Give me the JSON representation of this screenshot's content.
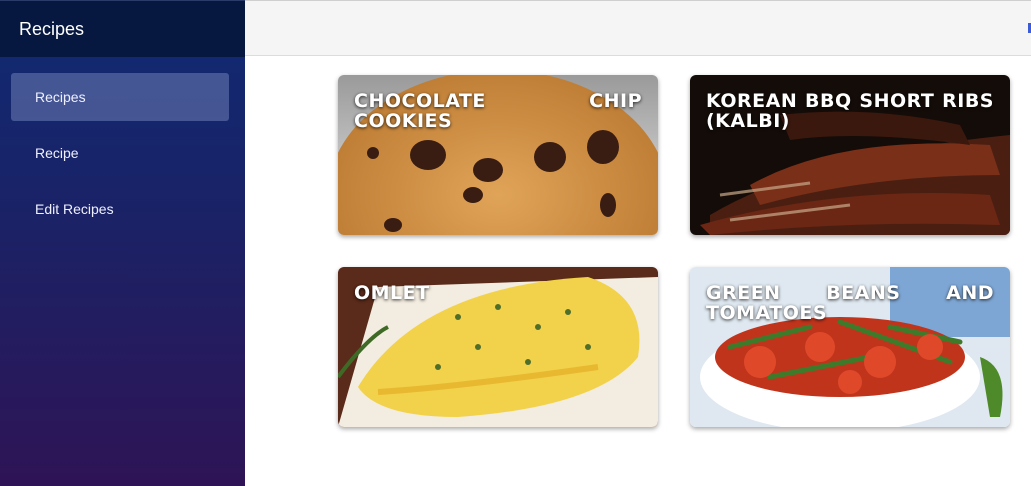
{
  "sidebar": {
    "title": "Recipes",
    "items": [
      {
        "label": "Recipes",
        "active": true
      },
      {
        "label": "Recipe",
        "active": false
      },
      {
        "label": "Edit Recipes",
        "active": false
      }
    ]
  },
  "cards": [
    {
      "title": "CHOCOLATE CHIP COOKIES",
      "image": "cookie-image"
    },
    {
      "title": "KOREAN BBQ SHORT RIBS (KALBI)",
      "image": "ribs-image"
    },
    {
      "title": "OMLET",
      "image": "omelet-image"
    },
    {
      "title": "GREEN BEANS AND TOMATOES",
      "image": "beans-tomatoes-image"
    }
  ],
  "colors": {
    "sidebar_header": "#06183f",
    "sidebar_top": "#0f2a73",
    "sidebar_bottom": "#2e1456",
    "accent": "#3b5bd8"
  }
}
